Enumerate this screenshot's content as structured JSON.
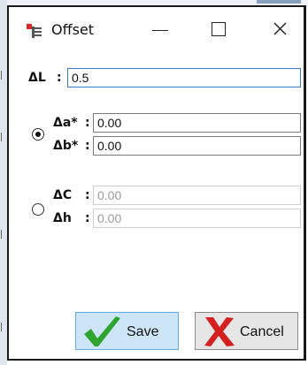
{
  "window": {
    "title": "Offset",
    "minimize_glyph": "",
    "maximize_glyph": "",
    "close_glyph": ""
  },
  "form": {
    "delta_l_label": "ΔL",
    "delta_l_colon": ":",
    "delta_l_value": "0.5",
    "group_ab": {
      "selected": true,
      "delta_a_label": "Δa*",
      "delta_a_colon": ":",
      "delta_a_value": "0.00",
      "delta_b_label": "Δb*",
      "delta_b_colon": ":",
      "delta_b_value": "0.00"
    },
    "group_ch": {
      "selected": false,
      "delta_c_label": "ΔC",
      "delta_c_colon": ":",
      "delta_c_value": "0.00",
      "delta_h_label": "Δh",
      "delta_h_colon": ":",
      "delta_h_value": "0.00"
    }
  },
  "buttons": {
    "save_label": "Save",
    "cancel_label": "Cancel"
  },
  "colors": {
    "save_check": "#2fa52f",
    "cancel_x": "#d42020",
    "save_bg": "#cde6f7",
    "focus_border": "#3a78d4"
  }
}
